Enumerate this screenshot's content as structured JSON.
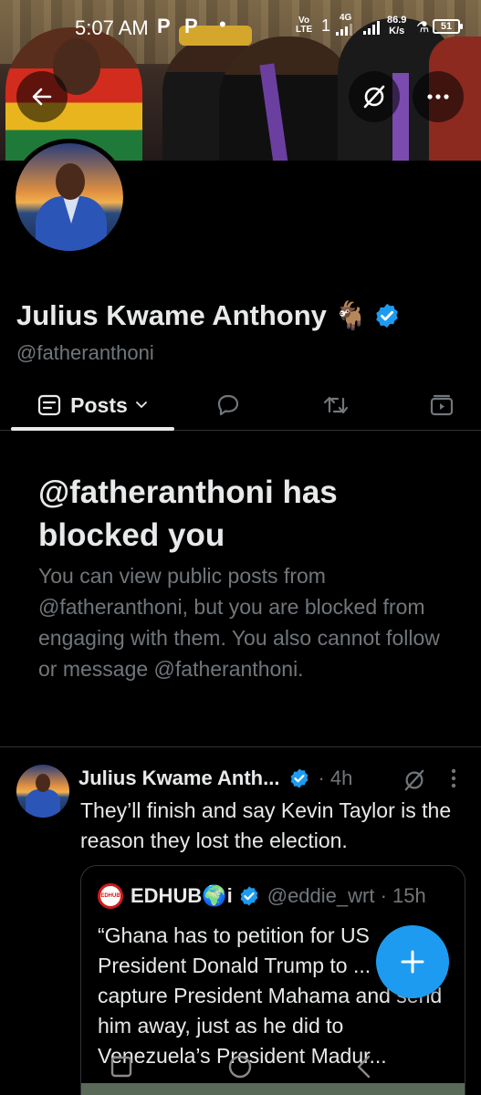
{
  "status_bar": {
    "time": "5:07 AM",
    "notif_1": "P",
    "notif_2": "P",
    "dot": "•",
    "volte": "Vo\nLTE",
    "sim1": "1",
    "net_type": "4G",
    "speed_value": "86.9",
    "speed_unit": "K/s",
    "battery": "51"
  },
  "profile": {
    "name": "Julius Kwame Anthony",
    "name_emoji": "🐐",
    "handle": "@fatheranthoni",
    "verified": true
  },
  "tabs": {
    "posts_label": "Posts"
  },
  "blocked": {
    "title": "@fatheranthoni has blocked you",
    "description": "You can view public posts from @fatheranthoni, but you are blocked from engaging with them. You also cannot follow or message @fatheranthoni."
  },
  "tweet": {
    "author_name": "Julius Kwame Anth...",
    "time": "· 4h",
    "text": "They’ll finish and say Kevin Taylor is the reason they lost the election.",
    "quote": {
      "logo_text": "EDHUB",
      "author_name": "EDHUB🌍i",
      "handle_time": "@eddie_wrt · 15h",
      "text": "“Ghana has to petition for US President Donald Trump to ... and capture President Mahama and send him away, just as he did to Venezuela’s President Madur..."
    }
  },
  "colors": {
    "accent": "#1d9bf0",
    "background": "#000000",
    "text_primary": "#e7e9ea",
    "text_secondary": "#71767b",
    "divider": "#2f3336"
  }
}
